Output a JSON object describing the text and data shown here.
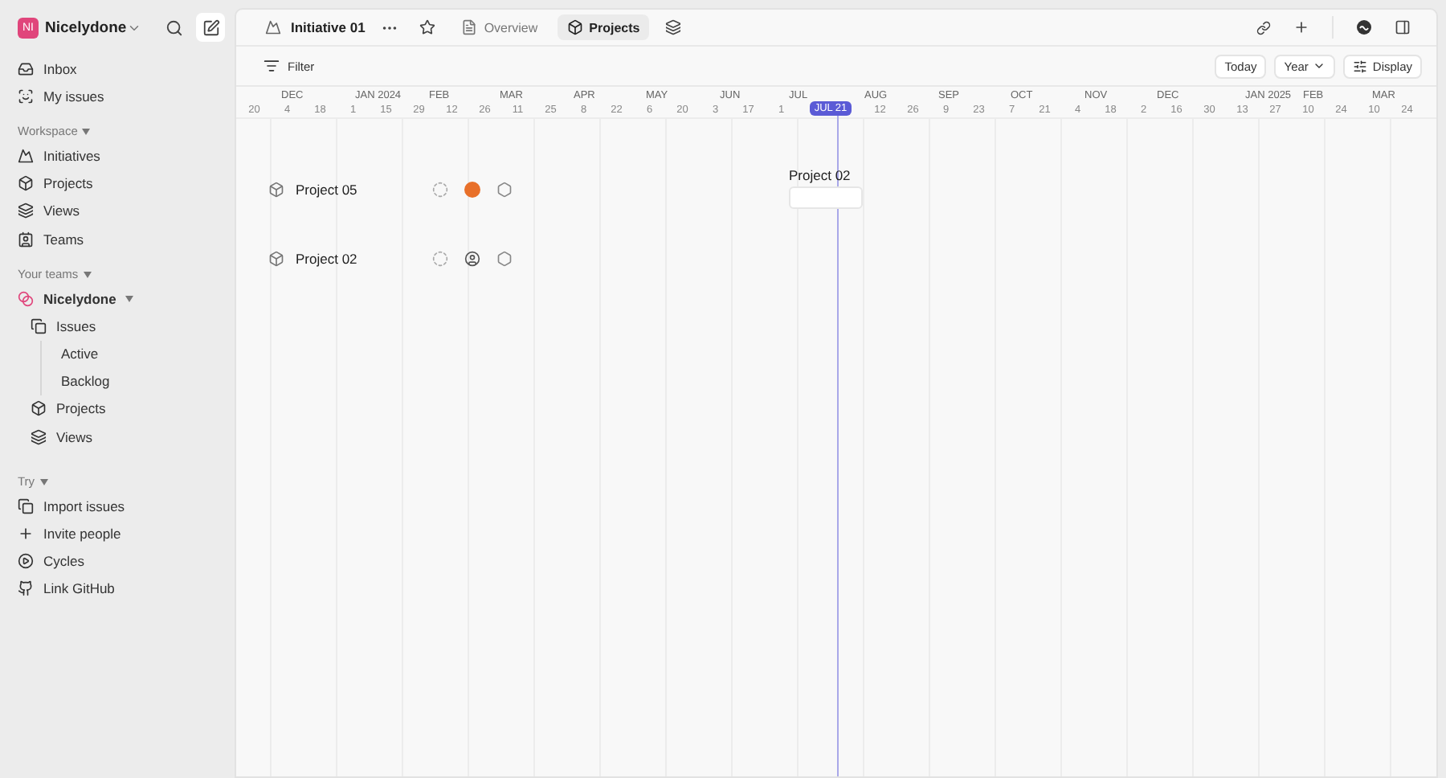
{
  "workspace": {
    "initials": "NI",
    "name": "Nicelydone"
  },
  "nav": [
    {
      "label": "Inbox"
    },
    {
      "label": "My issues"
    }
  ],
  "workspace_section": {
    "title": "Workspace",
    "items": [
      {
        "label": "Initiatives"
      },
      {
        "label": "Projects"
      },
      {
        "label": "Views"
      },
      {
        "label": "Teams"
      }
    ]
  },
  "teams_section": {
    "title": "Your teams",
    "team": "Nicelydone",
    "items": [
      {
        "label": "Issues",
        "children": [
          {
            "label": "Active"
          },
          {
            "label": "Backlog"
          }
        ]
      },
      {
        "label": "Projects"
      },
      {
        "label": "Views"
      }
    ]
  },
  "try_section": {
    "title": "Try",
    "items": [
      {
        "label": "Import issues"
      },
      {
        "label": "Invite people"
      },
      {
        "label": "Cycles"
      },
      {
        "label": "Link GitHub"
      }
    ]
  },
  "header": {
    "title": "Initiative 01",
    "tabs": [
      {
        "label": "Overview",
        "selected": false
      },
      {
        "label": "Projects",
        "selected": true
      }
    ]
  },
  "toolbar": {
    "filter": "Filter",
    "today": "Today",
    "zoom": "Year",
    "display": "Display"
  },
  "timeline": {
    "months": [
      "DEC",
      "JAN 2024",
      "FEB",
      "MAR",
      "APR",
      "MAY",
      "JUN",
      "JUL",
      "AUG",
      "SEP",
      "OCT",
      "NOV",
      "DEC",
      "JAN 2025",
      "FEB",
      "MAR"
    ],
    "days_before_today": [
      "20",
      "4",
      "18",
      "1",
      "15",
      "29",
      "12",
      "26",
      "11",
      "25",
      "8",
      "22",
      "6",
      "20",
      "3",
      "17",
      "1"
    ],
    "today": "JUL 21",
    "days_after_today": [
      "12",
      "26",
      "9",
      "23",
      "7",
      "21",
      "4",
      "18",
      "2",
      "16",
      "30",
      "13",
      "27",
      "10",
      "24",
      "10",
      "24"
    ]
  },
  "projects": [
    {
      "name": "Project 05",
      "kind": "avatar"
    },
    {
      "name": "Project 02",
      "kind": "no-lead",
      "bar_label": "Project 02"
    }
  ]
}
